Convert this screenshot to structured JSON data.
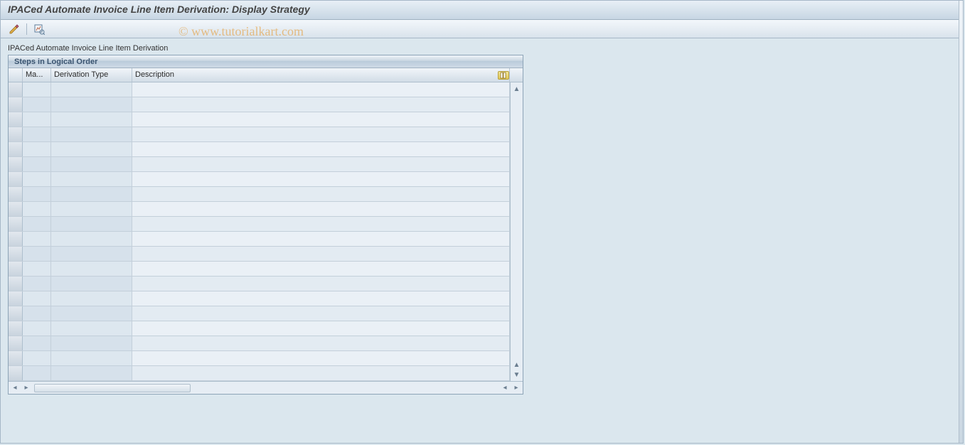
{
  "window": {
    "title": "IPACed Automate Invoice Line Item Derivation: Display Strategy"
  },
  "toolbar": {
    "icon1": "pencil-glasses-icon",
    "icon2": "analysis-icon"
  },
  "section": {
    "label": "IPACed Automate Invoice Line Item Derivation"
  },
  "group": {
    "title": "Steps in Logical Order"
  },
  "columns": {
    "sel": "",
    "ma": "Ma...",
    "deriv": "Derivation Type",
    "desc": "Description"
  },
  "rows_count": 20,
  "watermark": "© www.tutorialkart.com"
}
